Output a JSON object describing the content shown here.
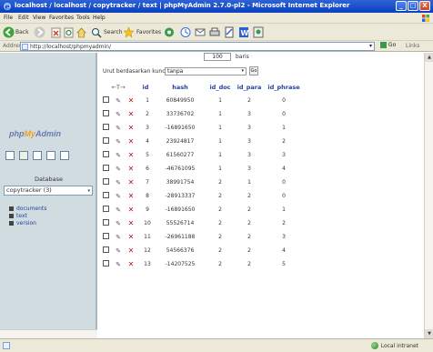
{
  "window": {
    "title": "localhost / localhost / copytracker / text | phpMyAdmin 2.7.0-pl2 - Microsoft Internet Explorer",
    "min": "_",
    "max": "□",
    "close": "X"
  },
  "menu": [
    "File",
    "Edit",
    "View",
    "Favorites",
    "Tools",
    "Help"
  ],
  "toolbar": {
    "back": "Back",
    "search": "Search",
    "favorites": "Favorites"
  },
  "address": {
    "label": "Address",
    "url": "http://localhost/phpmyadmin/",
    "go": "Go",
    "links": "Links"
  },
  "left": {
    "logo": {
      "php": "php",
      "my": "My",
      "admin": "Admin"
    },
    "database_label": "Database",
    "database_selected": "copytracker (3)",
    "tables": [
      "documents",
      "text",
      "version"
    ]
  },
  "right": {
    "rows_value": "100",
    "rows_suffix": "baris",
    "sort_label": "Urut berdasarkan kunci:",
    "sort_value": "tanpa",
    "go_label": "Go",
    "columns": [
      "id",
      "hash",
      "id_doc",
      "id_para",
      "id_phrase"
    ],
    "rows": [
      [
        "1",
        "60849950",
        "1",
        "2",
        "0"
      ],
      [
        "2",
        "33736702",
        "1",
        "3",
        "0"
      ],
      [
        "3",
        "-16891650",
        "1",
        "3",
        "1"
      ],
      [
        "4",
        "23924817",
        "1",
        "3",
        "2"
      ],
      [
        "5",
        "61560277",
        "1",
        "3",
        "3"
      ],
      [
        "6",
        "-46761095",
        "1",
        "3",
        "4"
      ],
      [
        "7",
        "38991754",
        "2",
        "1",
        "0"
      ],
      [
        "8",
        "-28913337",
        "2",
        "2",
        "0"
      ],
      [
        "9",
        "-16891650",
        "2",
        "2",
        "1"
      ],
      [
        "10",
        "55526714",
        "2",
        "2",
        "2"
      ],
      [
        "11",
        "-26961188",
        "2",
        "2",
        "3"
      ],
      [
        "12",
        "54566376",
        "2",
        "2",
        "4"
      ],
      [
        "13",
        "-14207525",
        "2",
        "2",
        "5"
      ]
    ]
  },
  "status": {
    "zone": "Local intranet"
  }
}
